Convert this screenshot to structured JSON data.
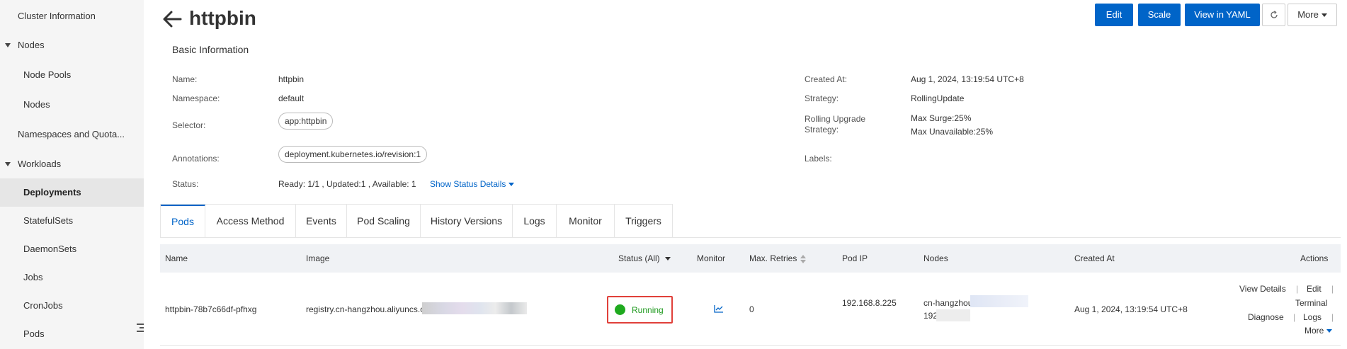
{
  "sidebar": {
    "items": [
      {
        "label": "Cluster Information"
      },
      {
        "label": "Nodes"
      },
      {
        "label": "Node Pools"
      },
      {
        "label": "Nodes"
      },
      {
        "label": "Namespaces and Quota..."
      },
      {
        "label": "Workloads"
      },
      {
        "label": "Deployments"
      },
      {
        "label": "StatefulSets"
      },
      {
        "label": "DaemonSets"
      },
      {
        "label": "Jobs"
      },
      {
        "label": "CronJobs"
      },
      {
        "label": "Pods"
      }
    ]
  },
  "header": {
    "title": "httpbin",
    "buttons": {
      "edit": "Edit",
      "scale": "Scale",
      "view_yaml": "View in YAML",
      "more": "More"
    }
  },
  "basic_info": {
    "title": "Basic Information",
    "name_label": "Name:",
    "name_value": "httpbin",
    "namespace_label": "Namespace:",
    "namespace_value": "default",
    "selector_label": "Selector:",
    "selector_value": "app:httpbin",
    "annotations_label": "Annotations:",
    "annotations_value": "deployment.kubernetes.io/revision:1",
    "status_label": "Status:",
    "status_value": "Ready: 1/1 ,  Updated:1 ,  Available: 1",
    "status_link": "Show Status Details",
    "created_label": "Created At:",
    "created_value": "Aug 1, 2024, 13:19:54 UTC+8",
    "strategy_label": "Strategy:",
    "strategy_value": "RollingUpdate",
    "rolling_label_1": "Rolling Upgrade",
    "rolling_label_2": "Strategy:",
    "max_surge": "Max Surge:25%",
    "max_unavailable": "Max Unavailable:25%",
    "labels_label": "Labels:"
  },
  "tabs": [
    {
      "label": "Pods"
    },
    {
      "label": "Access Method"
    },
    {
      "label": "Events"
    },
    {
      "label": "Pod Scaling"
    },
    {
      "label": "History Versions"
    },
    {
      "label": "Logs"
    },
    {
      "label": "Monitor"
    },
    {
      "label": "Triggers"
    }
  ],
  "table": {
    "columns": {
      "name": "Name",
      "image": "Image",
      "status": "Status (All)",
      "monitor": "Monitor",
      "retries": "Max. Retries",
      "pod_ip": "Pod IP",
      "nodes": "Nodes",
      "created": "Created At",
      "actions": "Actions"
    },
    "rows": [
      {
        "name": "httpbin-78b7c66df-pfhxg",
        "image": "registry.cn-hangzhou.aliyuncs.c",
        "status": "Running",
        "retries": "0",
        "pod_ip": "192.168.8.225",
        "node_line1": "cn-hangzhou",
        "node_line2": "192",
        "created": "Aug 1, 2024, 13:19:54 UTC+8",
        "actions": {
          "view_details": "View Details",
          "edit": "Edit",
          "terminal": "Terminal",
          "diagnose": "Diagnose",
          "logs": "Logs",
          "more": "More"
        }
      }
    ]
  },
  "colors": {
    "primary": "#0064c8",
    "running": "#1faa1f",
    "highlight_border": "#e0403a"
  }
}
